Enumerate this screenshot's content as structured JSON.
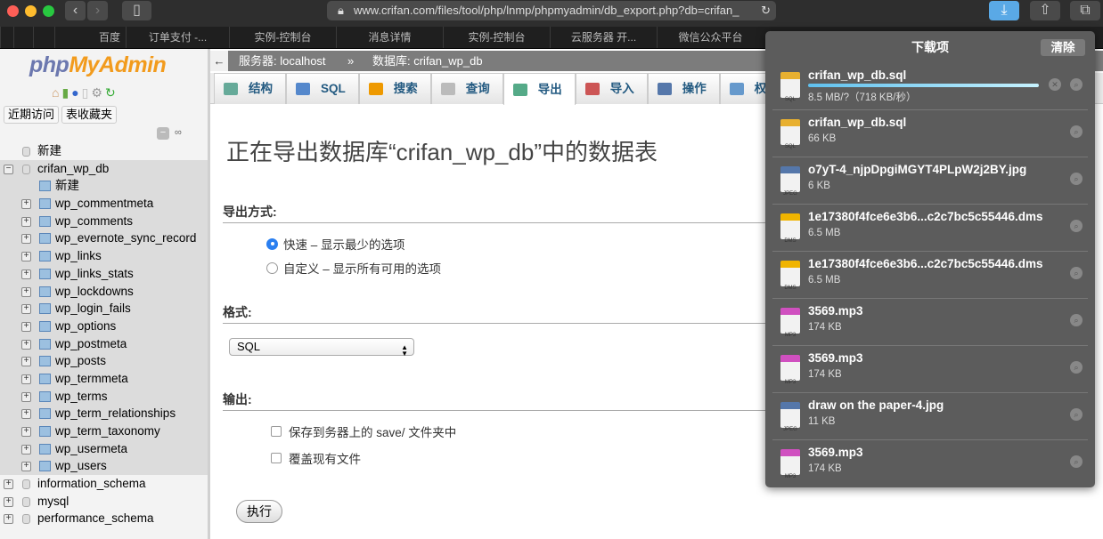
{
  "browser": {
    "url": "www.crifan.com/files/tool/php/lnmp/phpmyadmin/db_export.php?db=crifan_",
    "bookmarks": [
      "百度",
      "订单支付 -...",
      "实例-控制台",
      "消息详情",
      "实例-控制台",
      "云服务器 开...",
      "微信公众平台"
    ]
  },
  "sidebar": {
    "logo": "phpMyAdmin",
    "recent": "近期访问",
    "favorites": "表收藏夹",
    "new_db": "新建",
    "db": "crifan_wp_db",
    "new_table": "新建",
    "tables": [
      "wp_commentmeta",
      "wp_comments",
      "wp_evernote_sync_record",
      "wp_links",
      "wp_links_stats",
      "wp_lockdowns",
      "wp_login_fails",
      "wp_options",
      "wp_postmeta",
      "wp_posts",
      "wp_termmeta",
      "wp_terms",
      "wp_term_relationships",
      "wp_term_taxonomy",
      "wp_usermeta",
      "wp_users"
    ],
    "other_dbs": [
      "information_schema",
      "mysql",
      "performance_schema"
    ]
  },
  "main": {
    "breadcrumb": {
      "server": "服务器: localhost",
      "sep": "»",
      "database": "数据库: crifan_wp_db"
    },
    "tabs": [
      "结构",
      "SQL",
      "搜索",
      "查询",
      "导出",
      "导入",
      "操作",
      "权限"
    ],
    "title": "正在导出数据库“crifan_wp_db”中的数据表",
    "export_method_label": "导出方式:",
    "quick": "快速 – 显示最少的选项",
    "custom": "自定义 – 显示所有可用的选项",
    "format_label": "格式:",
    "format_value": "SQL",
    "output_label": "输出:",
    "save_server": "保存到务器上的 save/ 文件夹中",
    "overwrite": "覆盖现有文件",
    "go": "执行"
  },
  "downloads": {
    "title": "下载项",
    "clear": "清除",
    "items": [
      {
        "name": "crifan_wp_db.sql",
        "size": "8.5 MB/?（718 KB/秒）",
        "type": "SQL",
        "progress": 0.97
      },
      {
        "name": "crifan_wp_db.sql",
        "size": "66 KB",
        "type": "SQL"
      },
      {
        "name": "o7yT-4_njpDpgiMGYT4PLpW2j2BY.jpg",
        "size": "6 KB",
        "type": "JPEG"
      },
      {
        "name": "1e17380f4fce6e3b6...c2c7bc5c55446.dms",
        "size": "6.5 MB",
        "type": "DMS"
      },
      {
        "name": "1e17380f4fce6e3b6...c2c7bc5c55446.dms",
        "size": "6.5 MB",
        "type": "DMS"
      },
      {
        "name": "3569.mp3",
        "size": "174 KB",
        "type": "MP3"
      },
      {
        "name": "3569.mp3",
        "size": "174 KB",
        "type": "MP3"
      },
      {
        "name": "draw on the paper-4.jpg",
        "size": "11 KB",
        "type": "JPEG"
      },
      {
        "name": "3569.mp3",
        "size": "174 KB",
        "type": "MP3"
      }
    ]
  }
}
